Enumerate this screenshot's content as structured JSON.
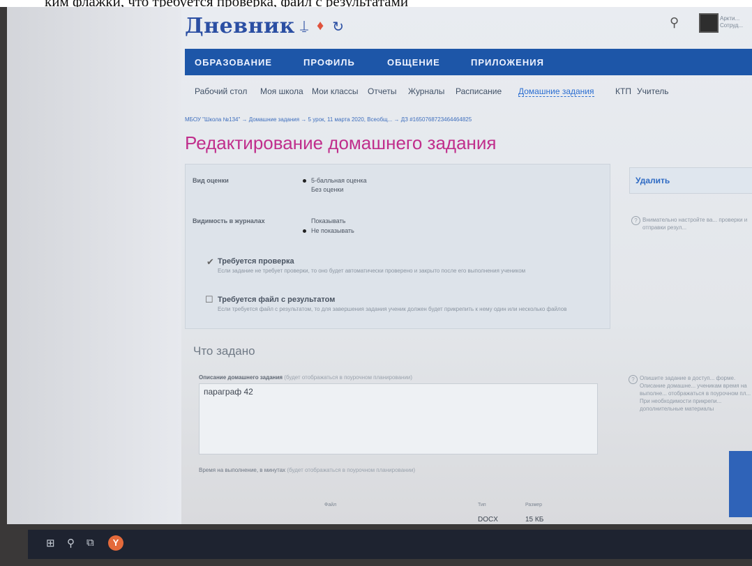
{
  "caption": "ким флажки, что требуется проверка, файл с результатами",
  "header": {
    "logo": "Дневник",
    "user_name": "Аркти...",
    "user_role": "Сотруд..."
  },
  "nav": {
    "items": [
      "ОБРАЗОВАНИЕ",
      "ПРОФИЛЬ",
      "ОБЩЕНИЕ",
      "ПРИЛОЖЕНИЯ"
    ]
  },
  "subnav": {
    "items": [
      "Рабочий стол",
      "Моя школа",
      "Мои классы",
      "Отчеты",
      "Журналы",
      "Расписание",
      "Домашние задания",
      "КТП",
      "Учитель"
    ],
    "active": "Домашние задания"
  },
  "breadcrumb": "МБОУ \"Школа №134\" → Домашние задания → 5 урок, 11 марта 2020, Всеобщ... → ДЗ #1650768723464464825",
  "page_title": "Редактирование домашнего задания",
  "grading": {
    "label": "Вид оценки",
    "options": [
      "5-балльная оценка",
      "Без оценки"
    ],
    "selected": "5-балльная оценка"
  },
  "visibility": {
    "label": "Видимость в журналах",
    "options": [
      "Показывать",
      "Не показывать"
    ],
    "selected": "Не показывать"
  },
  "check_required": {
    "title": "Требуется проверка",
    "description": "Если задание не требует проверки, то оно будет автоматически проверено и закрыто после его выполнения учеником",
    "checked": true
  },
  "file_required": {
    "title": "Требуется файл с результатом",
    "description": "Если требуется файл с результатом, то для завершения задания ученик должен будет прикрепить к нему один или несколько файлов",
    "checked": false
  },
  "section_title": "Что задано",
  "description_field": {
    "label": "Описание домашнего задания",
    "hint": "(будет отображаться в поурочном планировании)",
    "value": "параграф 42"
  },
  "time_field": {
    "label": "Время на выполнение, в минутах",
    "hint": "(будет отображаться в поурочном планировании)"
  },
  "files_table": {
    "headers": [
      "Файл",
      "Тип",
      "Размер"
    ],
    "row": {
      "type": "DOCX",
      "size": "15 КБ"
    }
  },
  "sidebar": {
    "delete_label": "Удалить",
    "hint1": "Внимательно настройте ва... проверки и отправки резул...",
    "hint2": "Опишите задание в доступ... форме. Описание домашне... ученикам время на выполне... отображаться в поурочном пл... При необходимости прикрепи... дополнительные материалы"
  },
  "colors": {
    "brand": "#1d56a8",
    "title": "#c02e8c",
    "link": "#2f6bc4"
  }
}
